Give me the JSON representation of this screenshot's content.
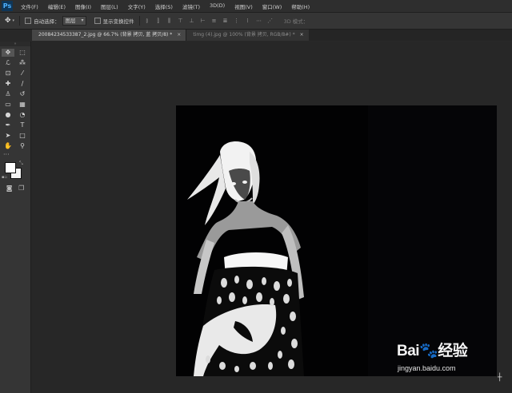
{
  "app": {
    "logo": "Ps"
  },
  "menu": [
    "文件(F)",
    "编辑(E)",
    "图像(I)",
    "图层(L)",
    "文字(Y)",
    "选择(S)",
    "滤镜(T)",
    "3D(D)",
    "视图(V)",
    "窗口(W)",
    "帮助(H)"
  ],
  "options": {
    "tool_icon": "move-icon",
    "auto_select_label": "自动选择：",
    "auto_select_value": "图层",
    "show_transform_label": "显示变换控件",
    "mode_3d_label": "3D 模式："
  },
  "tabs": [
    {
      "label": "20084234533387_2.jpg @ 66.7% (背景 拷贝, 蓝 拷贝/8) *",
      "close": "×",
      "active": true
    },
    {
      "label": "timg (4).jpg @ 100% (背景 拷贝, RGB/8#) *",
      "close": "×",
      "active": false
    }
  ],
  "toolbox": {
    "collapse": "»",
    "tools": [
      {
        "name": "move-tool",
        "glyph": "✥"
      },
      {
        "name": "marquee-tool",
        "glyph": "⬚"
      },
      {
        "name": "lasso-tool",
        "glyph": "ℒ"
      },
      {
        "name": "magic-wand-tool",
        "glyph": "⁂"
      },
      {
        "name": "crop-tool",
        "glyph": "⊡"
      },
      {
        "name": "eyedropper-tool",
        "glyph": "⁄"
      },
      {
        "name": "healing-brush-tool",
        "glyph": "✚"
      },
      {
        "name": "brush-tool",
        "glyph": "∕"
      },
      {
        "name": "clone-stamp-tool",
        "glyph": "♙"
      },
      {
        "name": "history-brush-tool",
        "glyph": "↺"
      },
      {
        "name": "eraser-tool",
        "glyph": "▭"
      },
      {
        "name": "gradient-tool",
        "glyph": "▦"
      },
      {
        "name": "blur-tool",
        "glyph": "●"
      },
      {
        "name": "dodge-tool",
        "glyph": "◔"
      },
      {
        "name": "pen-tool",
        "glyph": "✒"
      },
      {
        "name": "type-tool",
        "glyph": "T"
      },
      {
        "name": "path-selection-tool",
        "glyph": "➤"
      },
      {
        "name": "rectangle-tool",
        "glyph": "□"
      },
      {
        "name": "hand-tool",
        "glyph": "✋"
      },
      {
        "name": "zoom-tool",
        "glyph": "⚲"
      }
    ],
    "more": "···",
    "quick_mask": "◙",
    "screen_mode": "❐"
  },
  "colors": {
    "foreground": "#ffffff",
    "background": "#f2f2f2",
    "canvas_bg": "#020203",
    "workspace": "#272727"
  },
  "watermark": {
    "brand": "Bai🐾经验",
    "url": "jingyan.baidu.com"
  }
}
